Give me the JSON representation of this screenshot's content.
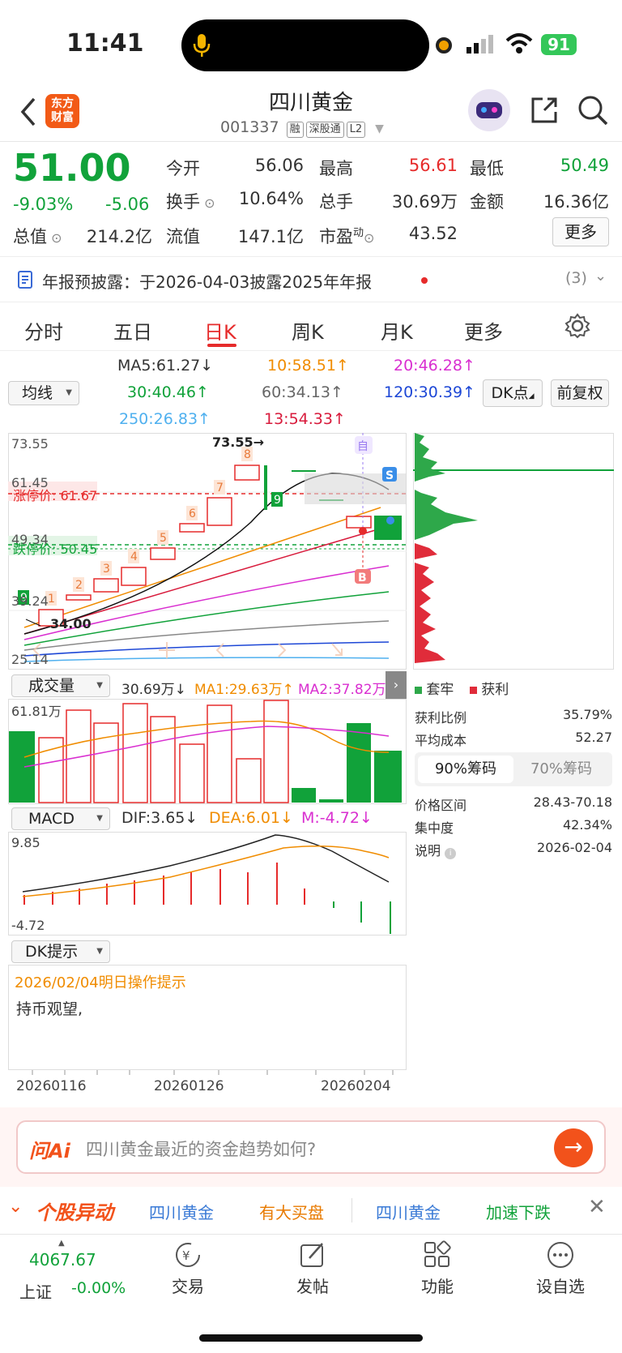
{
  "status": {
    "time": "11:41",
    "battery": "91"
  },
  "header": {
    "logo_line1": "东方",
    "logo_line2": "财富",
    "title": "四川黄金",
    "code": "001337",
    "tags": [
      "融",
      "深股通",
      "L2"
    ]
  },
  "quote": {
    "price": "51.00",
    "change_pct": "-9.03%",
    "change": "-5.06",
    "fields": [
      {
        "label": "今开",
        "value": "56.06"
      },
      {
        "label": "最高",
        "value": "56.61"
      },
      {
        "label": "最低",
        "value": "50.49"
      },
      {
        "label": "换手",
        "value": "10.64%"
      },
      {
        "label": "总手",
        "value": "30.69万"
      },
      {
        "label": "金额",
        "value": "16.36亿"
      },
      {
        "label": "总值",
        "value": "214.2亿"
      },
      {
        "label": "流值",
        "value": "147.1亿"
      },
      {
        "label": "市盈",
        "label_sup": "动",
        "value": "43.52"
      }
    ],
    "more_label": "更多"
  },
  "notice": {
    "text": "年报预披露：于2026-04-03披露2025年年报",
    "count": "(3)"
  },
  "tabs": [
    "分时",
    "五日",
    "日K",
    "周K",
    "月K",
    "更多"
  ],
  "ma": {
    "selector": "均线",
    "items": [
      "MA5:61.27↓",
      "10:58.51↑",
      "20:46.28↑",
      "30:40.46↑",
      "60:34.13↑",
      "120:30.39↑",
      "250:26.83↑",
      "13:54.33↑"
    ],
    "dk_label": "DK点",
    "fq_label": "前复权"
  },
  "kline": {
    "top_label": "73.55",
    "high_mark": "73.55→",
    "mid_label": "61.45",
    "low_label1": "49.34",
    "low_label2": "39.24",
    "bottom_label": "25.14",
    "limit_up": "涨停价: 61.67",
    "limit_down": "跌停价: 50.45",
    "low_mark": "34.00",
    "counts": [
      "1",
      "2",
      "3",
      "4",
      "5",
      "6",
      "7",
      "8",
      "9",
      "9"
    ],
    "self_label": "自",
    "s_label": "S",
    "b_label": "B"
  },
  "chip": {
    "legend_trapped": "套牢",
    "legend_profit": "获利",
    "rows": [
      {
        "label": "获利比例",
        "value": "35.79%"
      },
      {
        "label": "平均成本",
        "value": "52.27"
      }
    ],
    "tab_90": "90%筹码",
    "tab_70": "70%筹码",
    "rows2": [
      {
        "label": "价格区间",
        "value": "28.43-70.18"
      },
      {
        "label": "集中度",
        "value": "42.34%"
      },
      {
        "label": "说明",
        "value": "2026-02-04"
      }
    ]
  },
  "volume": {
    "selector": "成交量",
    "vol": "30.69万↓",
    "ma1": "MA1:29.63万↑",
    "ma2": "MA2:37.82万↑",
    "max_label": "61.81万"
  },
  "macd": {
    "selector": "MACD",
    "dif": "DIF:3.65↓",
    "dea": "DEA:6.01↓",
    "m": "M:-4.72↓",
    "top": "9.85",
    "bottom": "-4.72"
  },
  "dk": {
    "selector": "DK提示",
    "date_title": "2026/02/04明日操作提示",
    "advice": "持币观望,"
  },
  "dates": [
    "20260116",
    "20260126",
    "20260204"
  ],
  "ask": {
    "brand": "问Ai",
    "placeholder": "四川黄金最近的资金趋势如何?"
  },
  "ticker": {
    "title": "个股异动",
    "items": [
      "四川黄金",
      "有大买盘",
      "四川黄金",
      "加速下跌"
    ]
  },
  "bottom": {
    "index_value": "4067.67",
    "index_name": "上证",
    "index_change": "-0.00%",
    "items": [
      "交易",
      "发帖",
      "功能",
      "设自选"
    ]
  }
}
